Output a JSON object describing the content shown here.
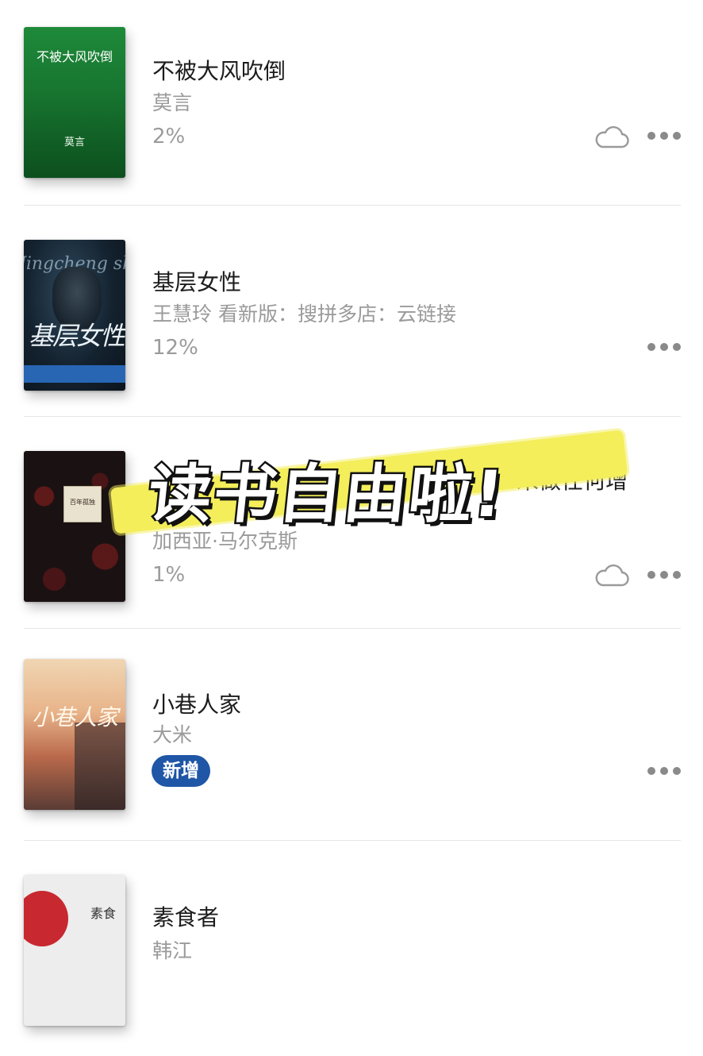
{
  "books": [
    {
      "title": "不被大风吹倒",
      "author": "莫言",
      "status": "2%",
      "cover_title": "不被大风吹倒",
      "cover_author": "莫言",
      "cloud": true
    },
    {
      "title": "基层女性",
      "author": "王慧玲 看新版：搜拼多店：云链接",
      "status": "12%",
      "cover_script": "Jingcheng shiye Di Jeanli",
      "cover_title": "基层女性",
      "cloud": false
    },
    {
      "title": "未做任何增",
      "author": "加西亚·马尔克斯",
      "status": "1%",
      "cover_label": "百年孤独",
      "cloud": true
    },
    {
      "title": "小巷人家",
      "author": "大米",
      "badge": "新增",
      "cover_title": "小巷人家",
      "cloud": false
    },
    {
      "title": "素食者",
      "author": "韩江",
      "cover_title": "素食",
      "cloud": false
    }
  ],
  "banner": {
    "text": "读书自由啦!"
  },
  "icons": {
    "cloud": "cloud-icon",
    "more": "more-dots-icon"
  },
  "colors": {
    "badge": "#1f56a6",
    "highlight": "#f3ee5a",
    "cover1": "#17742f"
  }
}
